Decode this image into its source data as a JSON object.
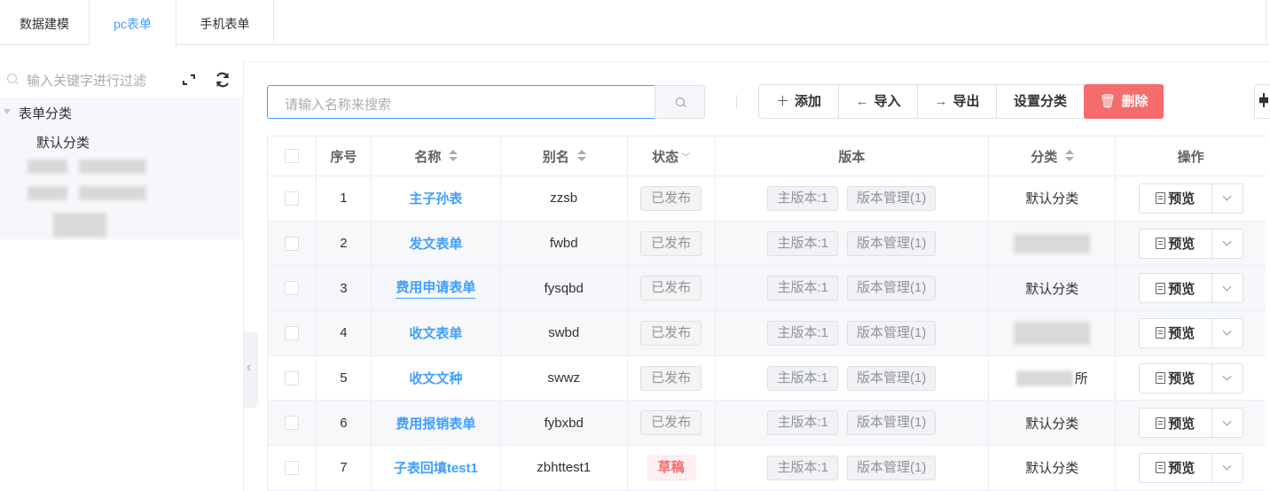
{
  "tabs": [
    {
      "label": "数据建模"
    },
    {
      "label": "pc表单",
      "active": true
    },
    {
      "label": "手机表单"
    }
  ],
  "sidebar": {
    "filter_placeholder": "输入关键字进行过滤",
    "tree_root": "表单分类",
    "tree_child": "默认分类"
  },
  "toolbar": {
    "search_placeholder": "请输入名称来搜索",
    "add_label": "添加",
    "import_label": "导入",
    "export_label": "导出",
    "set_category_label": "设置分类",
    "delete_label": "删除"
  },
  "table": {
    "headers": {
      "index": "序号",
      "name": "名称",
      "alias": "别名",
      "status": "状态",
      "version": "版本",
      "category": "分类",
      "action": "操作"
    },
    "rows": [
      {
        "index": "1",
        "name": "主子孙表",
        "alias": "zzsb",
        "status": "已发布",
        "main_version": "主版本:1",
        "version_mgmt": "版本管理(1)",
        "category": "默认分类",
        "preview": "预览"
      },
      {
        "index": "2",
        "name": "发文表单",
        "alias": "fwbd",
        "status": "已发布",
        "main_version": "主版本:1",
        "version_mgmt": "版本管理(1)",
        "category": "",
        "preview": "预览"
      },
      {
        "index": "3",
        "name": "费用申请表单",
        "alias": "fysqbd",
        "status": "已发布",
        "main_version": "主版本:1",
        "version_mgmt": "版本管理(1)",
        "category": "默认分类",
        "preview": "预览"
      },
      {
        "index": "4",
        "name": "收文表单",
        "alias": "swbd",
        "status": "已发布",
        "main_version": "主版本:1",
        "version_mgmt": "版本管理(1)",
        "category": "",
        "preview": "预览"
      },
      {
        "index": "5",
        "name": "收文文种",
        "alias": "swwz",
        "status": "已发布",
        "main_version": "主版本:1",
        "version_mgmt": "版本管理(1)",
        "category": "所",
        "preview": "预览"
      },
      {
        "index": "6",
        "name": "费用报销表单",
        "alias": "fybxbd",
        "status": "已发布",
        "main_version": "主版本:1",
        "version_mgmt": "版本管理(1)",
        "category": "默认分类",
        "preview": "预览"
      },
      {
        "index": "7",
        "name": "子表回填test1",
        "alias": "zbhttest1",
        "status": "草稿",
        "main_version": "主版本:1",
        "version_mgmt": "版本管理(1)",
        "category": "默认分类",
        "preview": "预览"
      }
    ]
  },
  "colors": {
    "primary": "#409eff",
    "danger": "#f56c6c"
  }
}
